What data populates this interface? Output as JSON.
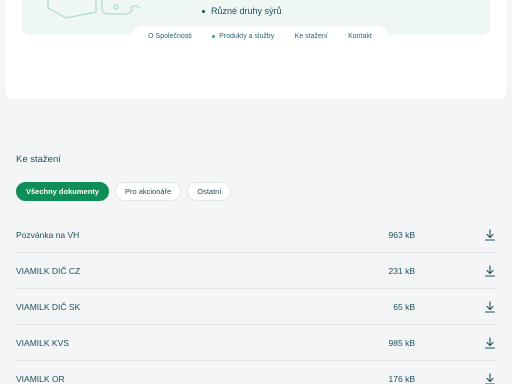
{
  "product": {
    "bullet_text": "Různé druhy sýrů"
  },
  "nav": {
    "items": [
      {
        "label": "O Společnosti",
        "active": false
      },
      {
        "label": "Produkty a služby",
        "active": true
      },
      {
        "label": "Ke stažení",
        "active": false
      },
      {
        "label": "Kontakt",
        "active": false
      }
    ]
  },
  "downloads": {
    "title": "Ke stažení",
    "filters": [
      {
        "label": "Všechny dokumenty",
        "active": true
      },
      {
        "label": "Pro akcionáře",
        "active": false
      },
      {
        "label": "Ostatní",
        "active": false
      }
    ],
    "documents": [
      {
        "name": "Pozvánka na VH",
        "size": "963 kB"
      },
      {
        "name": "VIAMILK DIČ CZ",
        "size": "231 kB"
      },
      {
        "name": "VIAMILK DIČ SK",
        "size": "65 kB"
      },
      {
        "name": "VIAMILK KVS",
        "size": "985 kB"
      },
      {
        "name": "VIAMILK OR",
        "size": "176 kB"
      }
    ]
  },
  "icons": {
    "download": "download-icon"
  },
  "colors": {
    "accent": "#0f8f57",
    "text": "#1f4f5c",
    "hero_bg": "#eef7f4"
  }
}
